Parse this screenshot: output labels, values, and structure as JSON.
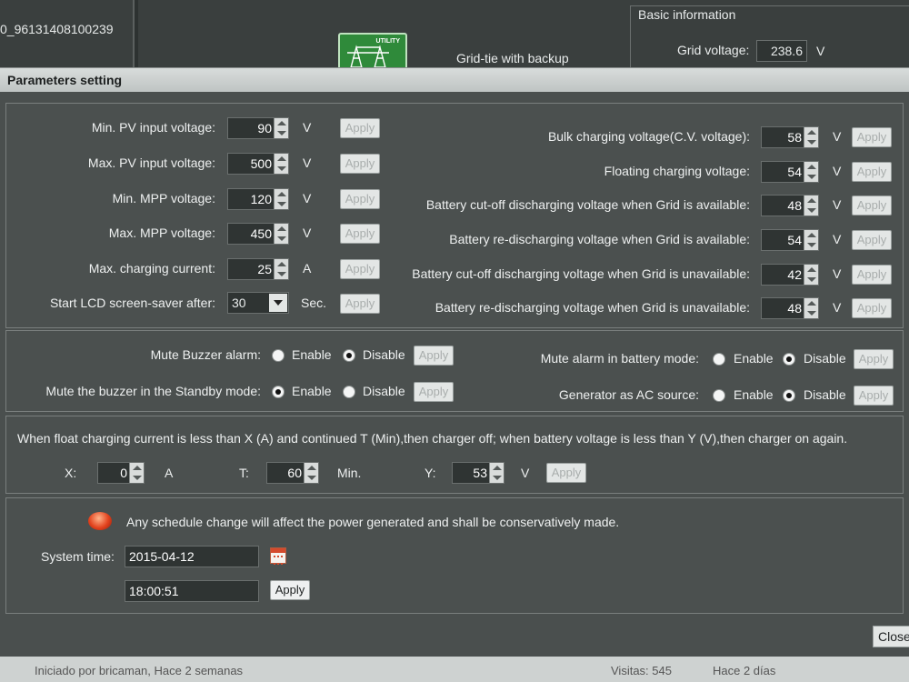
{
  "header": {
    "serial": "0_96131408100239",
    "mode_badge": "UTILITY",
    "mode_label": "Grid-tie with backup",
    "basic_info_title": "Basic information",
    "grid_voltage_label": "Grid voltage:",
    "grid_voltage_value": "238.6",
    "grid_voltage_unit": "V"
  },
  "dialog": {
    "title": "Parameters setting",
    "apply_label": "Apply",
    "close_label": "Close"
  },
  "left_params": [
    {
      "label": "Min. PV input voltage:",
      "value": "90",
      "unit": "V"
    },
    {
      "label": "Max. PV input voltage:",
      "value": "500",
      "unit": "V"
    },
    {
      "label": "Min. MPP voltage:",
      "value": "120",
      "unit": "V"
    },
    {
      "label": "Max. MPP voltage:",
      "value": "450",
      "unit": "V"
    },
    {
      "label": "Max. charging current:",
      "value": "25",
      "unit": "A"
    }
  ],
  "screensaver": {
    "label": "Start LCD screen-saver after:",
    "value": "30",
    "unit": "Sec."
  },
  "right_params": [
    {
      "label": "Bulk charging voltage(C.V. voltage):",
      "value": "58",
      "unit": "V"
    },
    {
      "label": "Floating charging voltage:",
      "value": "54",
      "unit": "V"
    },
    {
      "label": "Battery cut-off discharging voltage when Grid is available:",
      "value": "48",
      "unit": "V"
    },
    {
      "label": "Battery re-discharging voltage when Grid is available:",
      "value": "54",
      "unit": "V"
    },
    {
      "label": "Battery cut-off discharging voltage when Grid is unavailable:",
      "value": "42",
      "unit": "V"
    },
    {
      "label": "Battery re-discharging voltage when Grid is unavailable:",
      "value": "48",
      "unit": "V"
    }
  ],
  "toggles": {
    "enable_label": "Enable",
    "disable_label": "Disable",
    "items": [
      {
        "label": "Mute Buzzer alarm:",
        "selected": "Disable"
      },
      {
        "label": "Mute the buzzer in the Standby mode:",
        "selected": "Enable"
      },
      {
        "label": "Mute alarm in battery mode:",
        "selected": "Disable"
      },
      {
        "label": "Generator as AC source:",
        "selected": "Disable"
      }
    ]
  },
  "float_charge": {
    "description": "When float charging current is less than X (A) and continued T (Min),then charger off; when battery voltage is less than Y (V),then charger on again.",
    "x_label": "X:",
    "x_value": "0",
    "x_unit": "A",
    "t_label": "T:",
    "t_value": "60",
    "t_unit": "Min.",
    "y_label": "Y:",
    "y_value": "53",
    "y_unit": "V"
  },
  "schedule": {
    "warning": "Any schedule change will affect the power generated and shall be conservatively made.",
    "system_time_label": "System time:",
    "date": "2015-04-12",
    "time": "18:00:51"
  },
  "bottombar": {
    "left_text": "Iniciado por bricaman, Hace 2 semanas",
    "visits": "Visitas: 545",
    "ago": "Hace 2 días"
  }
}
